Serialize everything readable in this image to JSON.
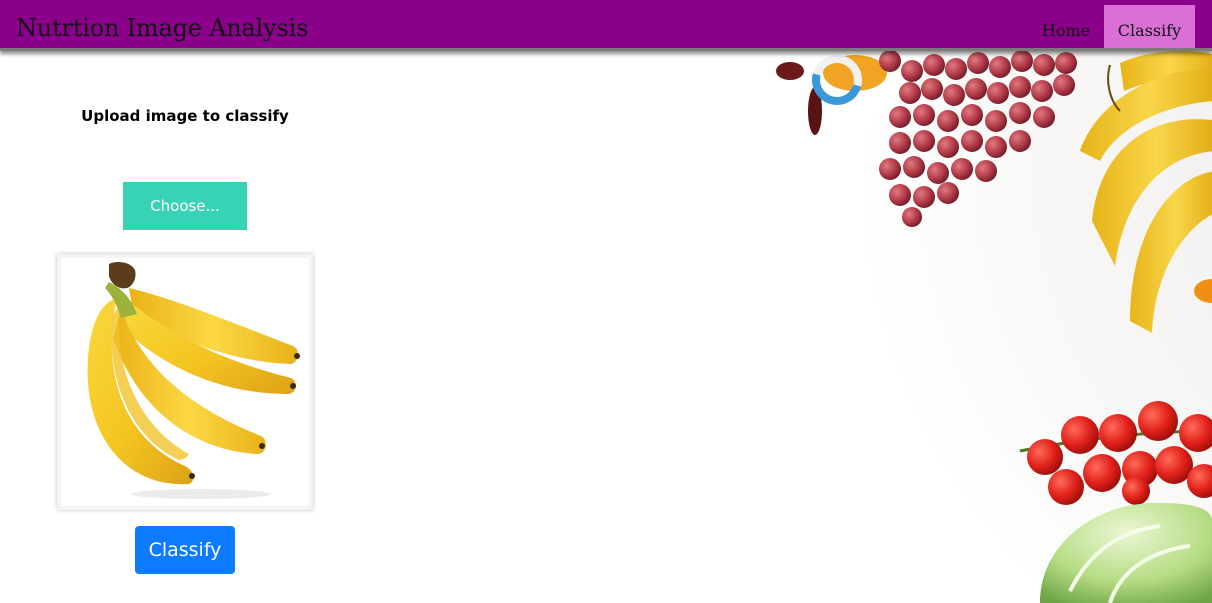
{
  "header": {
    "brand": "Nutrtion Image Analysis",
    "nav": [
      {
        "label": "Home",
        "active": false
      },
      {
        "label": "Classify",
        "active": true
      }
    ]
  },
  "upload": {
    "title": "Upload image to classify",
    "choose_label": "Choose...",
    "classify_label": "Classify"
  },
  "colors": {
    "navbar": "#8b008b",
    "active_nav": "#da70d6",
    "choose_button": "#38d3b4",
    "classify_button": "#0d7bff",
    "spinner_accent": "#3a98db"
  },
  "icons": {
    "preview": "banana-image",
    "loading": "loading-spinner-icon"
  }
}
